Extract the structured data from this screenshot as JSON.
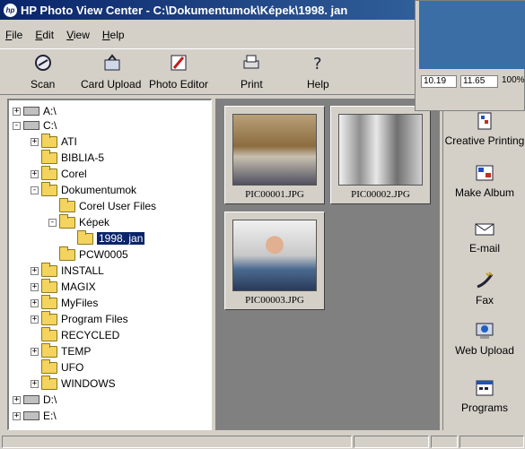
{
  "window": {
    "title": "HP Photo View Center - C:\\Dokumentumok\\Képek\\1998. jan",
    "logo": "hp"
  },
  "menu": [
    "File",
    "Edit",
    "View",
    "Help"
  ],
  "toolbar": [
    {
      "label": "Scan",
      "icon": "scanner-icon"
    },
    {
      "label": "Card Upload",
      "icon": "card-upload-icon"
    },
    {
      "label": "Photo Editor",
      "icon": "photo-editor-icon"
    },
    {
      "label": "Print",
      "icon": "printer-icon"
    },
    {
      "label": "Help",
      "icon": "help-icon"
    }
  ],
  "tree": [
    {
      "label": "A:\\",
      "type": "drive",
      "expander": "+"
    },
    {
      "label": "C:\\",
      "type": "drive",
      "expander": "-"
    },
    {
      "label": "ATI",
      "type": "folder",
      "expander": "+"
    },
    {
      "label": "BIBLIA-5",
      "type": "folder",
      "expander": ""
    },
    {
      "label": "Corel",
      "type": "folder",
      "expander": "+"
    },
    {
      "label": "Dokumentumok",
      "type": "folder",
      "expander": "-"
    },
    {
      "label": "Corel User Files",
      "type": "folder",
      "expander": ""
    },
    {
      "label": "Képek",
      "type": "folder",
      "expander": "-"
    },
    {
      "label": "1998. jan",
      "type": "folder-open",
      "expander": "",
      "selected": true
    },
    {
      "label": "PCW0005",
      "type": "folder",
      "expander": ""
    },
    {
      "label": "INSTALL",
      "type": "folder",
      "expander": "+"
    },
    {
      "label": "MAGIX",
      "type": "folder",
      "expander": "+"
    },
    {
      "label": "MyFiles",
      "type": "folder",
      "expander": "+"
    },
    {
      "label": "Program Files",
      "type": "folder",
      "expander": "+"
    },
    {
      "label": "RECYCLED",
      "type": "folder",
      "expander": ""
    },
    {
      "label": "TEMP",
      "type": "folder",
      "expander": "+"
    },
    {
      "label": "UFO",
      "type": "folder",
      "expander": ""
    },
    {
      "label": "WINDOWS",
      "type": "folder",
      "expander": "+"
    },
    {
      "label": "D:\\",
      "type": "drive",
      "expander": "+"
    },
    {
      "label": "E:\\",
      "type": "drive",
      "expander": "+"
    }
  ],
  "thumbnails": [
    {
      "filename": "PIC00001.JPG"
    },
    {
      "filename": "PIC00002.JPG"
    },
    {
      "filename": "PIC00003.JPG"
    }
  ],
  "sidebar": [
    {
      "label": "Creative Printing",
      "icon": "creative-printing-icon"
    },
    {
      "label": "Make Album",
      "icon": "make-album-icon"
    },
    {
      "label": "E-mail",
      "icon": "email-icon"
    },
    {
      "label": "Fax",
      "icon": "fax-icon"
    },
    {
      "label": "Web Upload",
      "icon": "web-upload-icon"
    },
    {
      "label": "Programs",
      "icon": "programs-icon"
    }
  ],
  "overlay": {
    "field1": "10.19",
    "field2": "11.65",
    "zoom": "100%"
  },
  "colors": {
    "titlebar": "#0a246a",
    "selection": "#0a246a",
    "panel": "#808080",
    "face": "#d4d0c8"
  }
}
